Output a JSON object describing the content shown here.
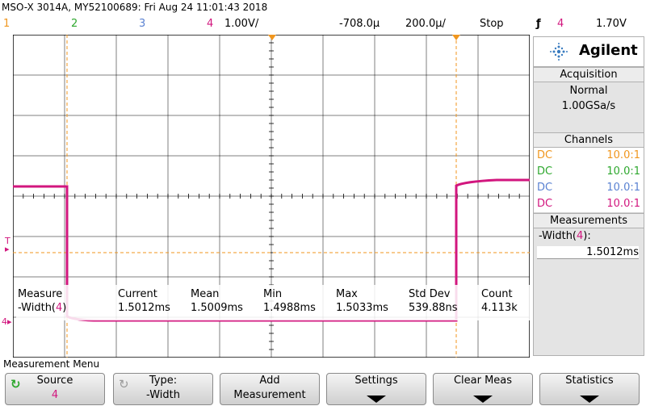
{
  "window_title": "MSO-X 3014A, MY52100689: Fri Aug 24 11:01:43 2018",
  "topbar": {
    "ch1": "1",
    "ch2": "2",
    "ch3": "3",
    "ch4": "4",
    "ch4_scale": "1.00V/",
    "delay": "-708.0µ",
    "timebase": "200.0µ/",
    "run_state": "Stop",
    "trigger_icon": "ƒ",
    "trigger_source": "4",
    "trigger_level": "1.70V"
  },
  "colors": {
    "ch1": "#f0961e",
    "ch2": "#2ea82e",
    "ch3": "#5a82d2",
    "ch4": "#d2167e",
    "grid": "#000000"
  },
  "waveform": {
    "high_level_fraction": 0.47,
    "low_level_fraction": 0.885,
    "note_cursor_left": "",
    "note_cursor_right": ""
  },
  "markers": {
    "ground_ch4": "4",
    "trigger_level_marker": "T"
  },
  "measure_table": {
    "headers": [
      "Measure",
      "Current",
      "Mean",
      "Min",
      "Max",
      "Std Dev",
      "Count"
    ],
    "row_label_prefix": "-Width(",
    "row_label_ch": "4",
    "row_label_suffix": ")",
    "values": [
      "1.5012ms",
      "1.5009ms",
      "1.4988ms",
      "1.5033ms",
      "539.88ns",
      "4.113k"
    ]
  },
  "side_panel": {
    "brand": "Agilent",
    "acq_header": "Acquisition",
    "acq_mode": "Normal",
    "acq_rate": "1.00GSa/s",
    "channels_header": "Channels",
    "channels": [
      {
        "coupling": "DC",
        "probe": "10.0:1"
      },
      {
        "coupling": "DC",
        "probe": "10.0:1"
      },
      {
        "coupling": "DC",
        "probe": "10.0:1"
      },
      {
        "coupling": "DC",
        "probe": "10.0:1"
      }
    ],
    "meas_header": "Measurements",
    "meas_label_prefix": "-Width(",
    "meas_label_ch": "4",
    "meas_label_suffix": "):",
    "meas_value": "1.5012ms"
  },
  "menu": {
    "title": "Measurement Menu",
    "softkeys": [
      {
        "line1": "Source",
        "line2": "4"
      },
      {
        "line1": "Type:",
        "line2": "-Width"
      },
      {
        "line1": "Add",
        "line2": "Measurement"
      },
      {
        "line1": "Settings",
        "line2": ""
      },
      {
        "line1": "Clear Meas",
        "line2": ""
      },
      {
        "line1": "Statistics",
        "line2": ""
      }
    ]
  }
}
